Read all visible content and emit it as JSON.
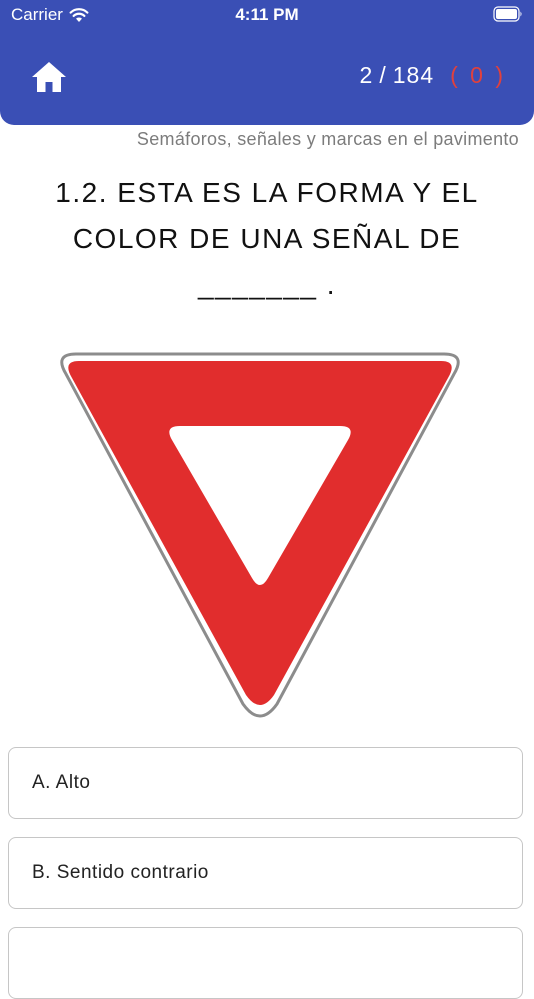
{
  "status_bar": {
    "carrier": "Carrier",
    "time": "4:11 PM"
  },
  "header": {
    "current": "2",
    "separator": "/",
    "total": "184",
    "wrong_count": "( 0 )",
    "home_icon": "home-icon",
    "background_color": "#3a4fb5",
    "wrong_color": "#e0413d"
  },
  "category": "Semáforos, señales y marcas en el pavimento",
  "question": {
    "line1": "1.2. ESTA ES LA FORMA Y EL",
    "line2": "COLOR DE UNA SEÑAL DE",
    "line3": "_______ ."
  },
  "sign": {
    "icon": "yield-sign-icon",
    "color": "#e12d2d"
  },
  "options": [
    {
      "label": "A. Alto"
    },
    {
      "label": "B. Sentido contrario"
    },
    {
      "label": ""
    }
  ]
}
